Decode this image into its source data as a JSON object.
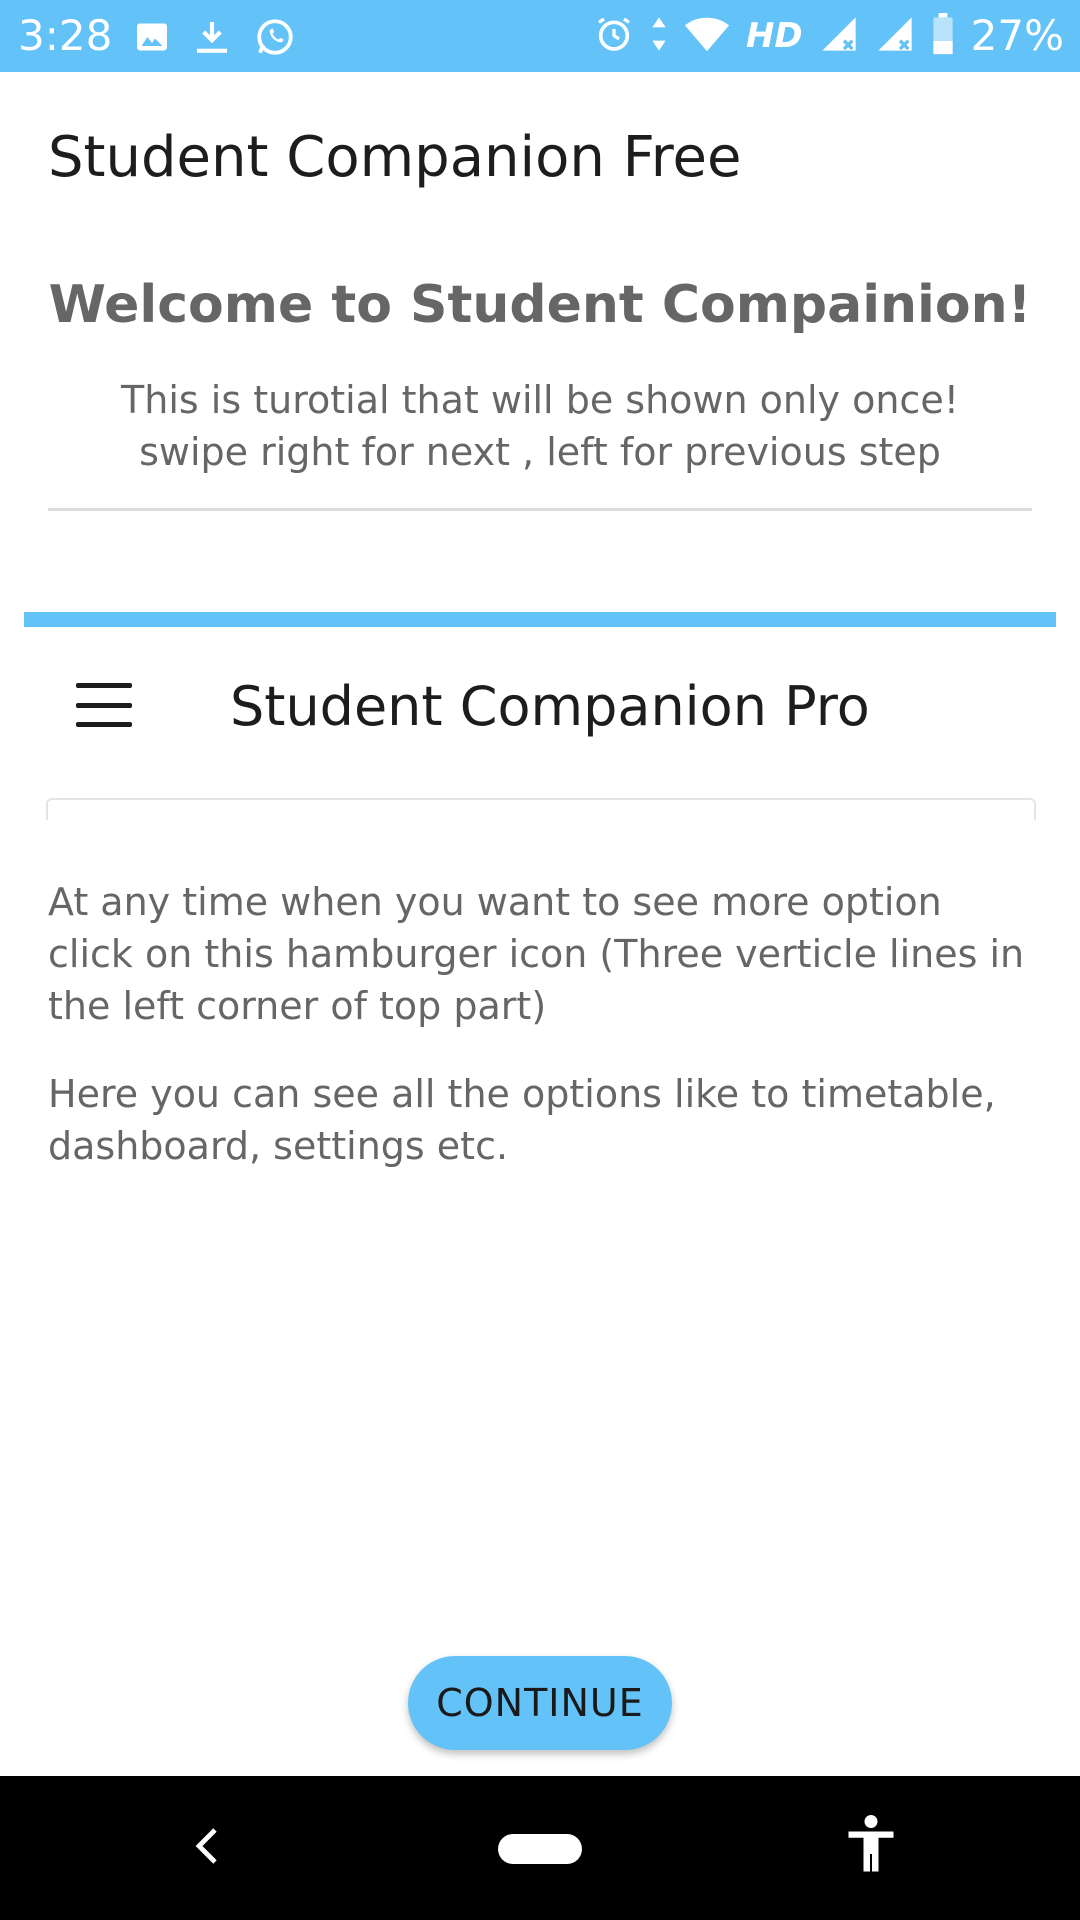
{
  "status_bar": {
    "time": "3:28",
    "network_label": "HD",
    "battery": "27%",
    "icons": [
      "image-icon",
      "download-icon",
      "whatsapp-icon",
      "alarm-icon",
      "data-arrows-icon",
      "wifi-icon",
      "signal-icon",
      "signal-icon",
      "battery-icon"
    ]
  },
  "app": {
    "title": "Student Companion Free"
  },
  "tutorial": {
    "heading": "Welcome to Student Compainion!",
    "intro_line1": "This is turotial that will be shown only once!",
    "intro_line2": "swipe right for next , left for previous step",
    "preview_title": "Student Companion Pro",
    "description1": "At any time when you want to see more option click on this hamburger icon (Three verticle lines in the left corner of top part)",
    "description2": "Here you can see all the options like to timetable, dashboard, settings etc.",
    "continue_label": "CONTINUE"
  },
  "colors": {
    "accent": "#63c2f7",
    "text_muted": "#666666",
    "text_dark": "#1d1d1d"
  }
}
